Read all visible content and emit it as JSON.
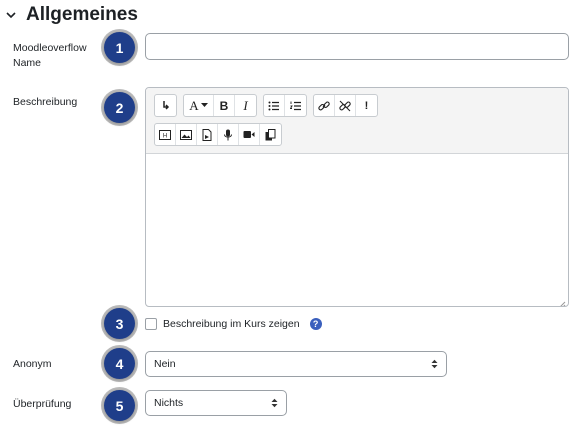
{
  "section": {
    "title": "Allgemeines"
  },
  "fields": {
    "name": {
      "label_line1": "Moodleoverflow",
      "label_line2": "Name",
      "value": ""
    },
    "description": {
      "label": "Beschreibung"
    },
    "show_description": {
      "label": "Beschreibung im Kurs zeigen"
    },
    "anonym": {
      "label": "Anonym",
      "value": "Nein"
    },
    "review": {
      "label": "Überprüfung",
      "value": "Nichts"
    }
  },
  "badges": [
    "1",
    "2",
    "3",
    "4",
    "5"
  ],
  "toolbar": {
    "row1": [
      "collapse-icon",
      "font-color-icon",
      "bold-icon",
      "italic-icon",
      "unordered-list-icon",
      "ordered-list-icon",
      "link-icon",
      "unlink-icon",
      "emoji-icon"
    ],
    "row2": [
      "h5p-icon",
      "image-icon",
      "media-icon",
      "record-audio-icon",
      "record-video-icon",
      "manage-files-icon"
    ],
    "bold_label": "B",
    "italic_label": "I",
    "font_label": "A",
    "emoji_label": "!"
  },
  "colors": {
    "badge": "#1f3e8a",
    "help": "#3a5fbd"
  }
}
